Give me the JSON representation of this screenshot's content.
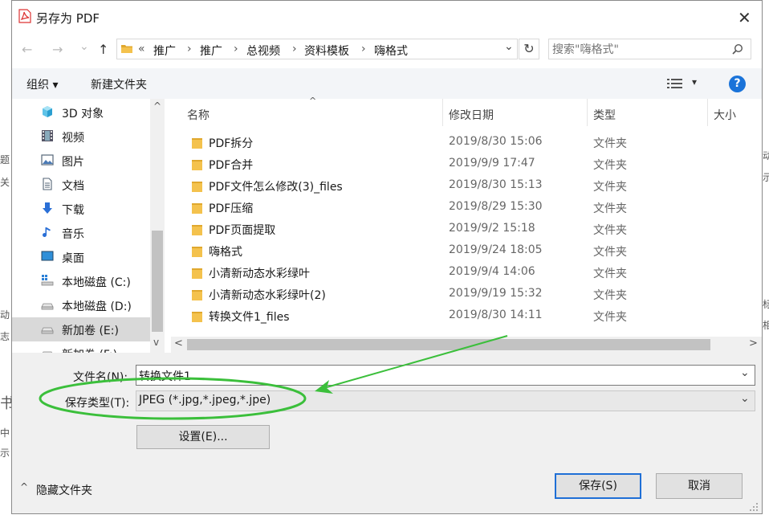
{
  "background_left_chars": [
    "题",
    "关",
    "动",
    "志",
    "书",
    "中",
    "示"
  ],
  "background_right_chars": [
    "动",
    "示",
    "标",
    "相"
  ],
  "dialog": {
    "title": "另存为 PDF",
    "pdf_icon": "pdf-icon",
    "close": "✕"
  },
  "nav": {
    "back": "←",
    "forward": "→",
    "recent": "⌄",
    "up": "↑"
  },
  "address": {
    "overflow": "«",
    "segments": [
      "推广",
      "推广",
      "总视频",
      "资料模板",
      "嗨格式"
    ],
    "separator": "›",
    "dropdown": "⌄",
    "refresh": "↻"
  },
  "search": {
    "placeholder": "搜索\"嗨格式\"",
    "icon": "search-icon"
  },
  "toolbar": {
    "organize": "组织 ▾",
    "new_folder": "新建文件夹",
    "view_icon": "view-details-icon",
    "view_arrow": "▾",
    "help": "?"
  },
  "sidebar": {
    "items": [
      {
        "label": "3D 对象",
        "icon": "3d-objects-icon"
      },
      {
        "label": "视频",
        "icon": "video-icon"
      },
      {
        "label": "图片",
        "icon": "pictures-icon"
      },
      {
        "label": "文档",
        "icon": "documents-icon"
      },
      {
        "label": "下载",
        "icon": "download-icon"
      },
      {
        "label": "音乐",
        "icon": "music-icon"
      },
      {
        "label": "桌面",
        "icon": "desktop-icon"
      },
      {
        "label": "本地磁盘 (C:)",
        "icon": "system-drive-icon"
      },
      {
        "label": "本地磁盘 (D:)",
        "icon": "drive-icon"
      },
      {
        "label": "新加卷 (E:)",
        "icon": "drive-icon",
        "selected": true
      },
      {
        "label": "新加卷 (F:)",
        "icon": "drive-icon"
      }
    ],
    "scroll_up": "^",
    "scroll_down": "v"
  },
  "columns": {
    "name": "名称",
    "date": "修改日期",
    "type": "类型",
    "size": "大小",
    "sort_indicator": "^"
  },
  "files": [
    {
      "name": "PDF拆分",
      "date": "2019/8/30 15:06",
      "type": "文件夹"
    },
    {
      "name": "PDF合并",
      "date": "2019/9/9 17:47",
      "type": "文件夹"
    },
    {
      "name": "PDF文件怎么修改(3)_files",
      "date": "2019/8/30 15:13",
      "type": "文件夹"
    },
    {
      "name": "PDF压缩",
      "date": "2019/8/29 15:30",
      "type": "文件夹"
    },
    {
      "name": "PDF页面提取",
      "date": "2019/9/2 15:18",
      "type": "文件夹"
    },
    {
      "name": "嗨格式",
      "date": "2019/9/24 18:05",
      "type": "文件夹"
    },
    {
      "name": "小清新动态水彩绿叶",
      "date": "2019/9/4 14:06",
      "type": "文件夹"
    },
    {
      "name": "小清新动态水彩绿叶(2)",
      "date": "2019/9/19 15:32",
      "type": "文件夹"
    },
    {
      "name": "转换文件1_files",
      "date": "2019/8/30 14:11",
      "type": "文件夹"
    }
  ],
  "hscroll": {
    "left": "<",
    "right": ">"
  },
  "form": {
    "filename_label": "文件名(N):",
    "filename_value": "转换文件1",
    "filetype_label": "保存类型(T):",
    "filetype_value": "JPEG (*.jpg,*.jpeg,*.jpe)",
    "dropdown": "⌄",
    "settings_button": "设置(E)..."
  },
  "footer": {
    "hide_folders": "隐藏文件夹",
    "hide_arrow": "^",
    "save": "保存(S)",
    "cancel": "取消"
  },
  "annotation": {
    "color": "#3bbf3b"
  }
}
